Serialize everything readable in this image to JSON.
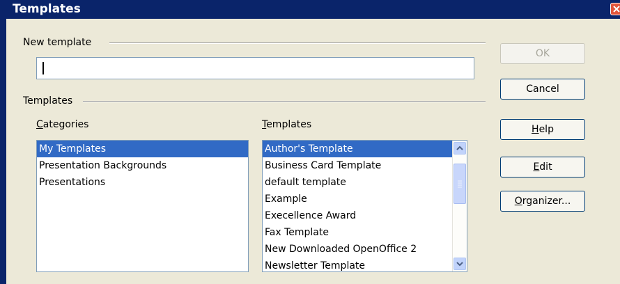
{
  "window": {
    "title": "Templates"
  },
  "new_template": {
    "section_label": "New template",
    "value": ""
  },
  "templates_section": {
    "label": "Templates",
    "categories_label": "Categories",
    "templates_label": "Templates",
    "categories": [
      {
        "label": "My Templates",
        "selected": true
      },
      {
        "label": "Presentation Backgrounds",
        "selected": false
      },
      {
        "label": "Presentations",
        "selected": false
      }
    ],
    "templates": [
      {
        "label": "Author's Template",
        "selected": true
      },
      {
        "label": "Business Card Template",
        "selected": false
      },
      {
        "label": "default template",
        "selected": false
      },
      {
        "label": "Example",
        "selected": false
      },
      {
        "label": "Execellence Award",
        "selected": false
      },
      {
        "label": "Fax Template",
        "selected": false
      },
      {
        "label": "New Downloaded OpenOffice 2",
        "selected": false
      },
      {
        "label": "Newsletter Template",
        "selected": false
      }
    ]
  },
  "buttons": {
    "ok": "OK",
    "cancel": "Cancel",
    "help": "Help",
    "edit": "Edit",
    "organizer": "Organizer..."
  },
  "colors": {
    "titlebar": "#0a246a",
    "selection": "#316ac5",
    "dialog_bg": "#ece9d8"
  }
}
